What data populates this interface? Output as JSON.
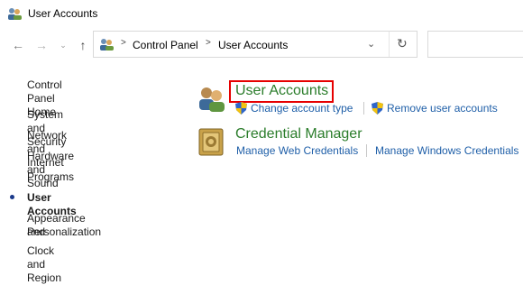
{
  "window": {
    "title": "User Accounts",
    "icon": "users-icon"
  },
  "nav": {
    "back_icon": "arrow-left-icon",
    "forward_icon": "arrow-right-icon",
    "recent_icon": "chevron-down-icon",
    "up_icon": "arrow-up-icon"
  },
  "address": {
    "crumbs": [
      "Control Panel",
      "User Accounts"
    ],
    "separator": ">",
    "dropdown_glyph": "⌄",
    "refresh_glyph": "↻"
  },
  "sidebar": {
    "items": [
      {
        "label": "Control Panel Home",
        "active": false
      },
      {
        "label": "System and Security",
        "active": false
      },
      {
        "label": "Network and Internet",
        "active": false
      },
      {
        "label": "Hardware and Sound",
        "active": false
      },
      {
        "label": "Programs",
        "active": false
      },
      {
        "label": "User Accounts",
        "active": true
      },
      {
        "label": "Appearance and",
        "active": false
      },
      {
        "label": "Personalization",
        "active": false
      },
      {
        "label": "Clock and Region",
        "active": false
      }
    ]
  },
  "categories": [
    {
      "title": "User Accounts",
      "icon": "users-icon",
      "links": [
        {
          "label": "Change account type",
          "shield": true
        },
        {
          "label": "Remove user accounts",
          "shield": true
        }
      ]
    },
    {
      "title": "Credential Manager",
      "icon": "vault-icon",
      "links": [
        {
          "label": "Manage Web Credentials",
          "shield": false
        },
        {
          "label": "Manage Windows Credentials",
          "shield": false
        }
      ]
    }
  ],
  "colors": {
    "accent_green": "#2b7d2b",
    "link_blue": "#1f5fa8",
    "highlight_red": "#e60000"
  }
}
